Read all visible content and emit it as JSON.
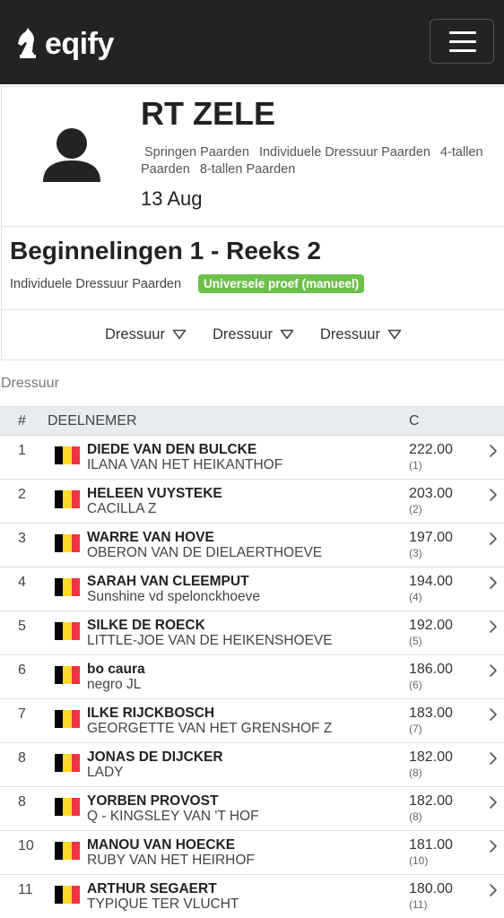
{
  "brand": {
    "name": "eqify"
  },
  "event": {
    "title": "RT ZELE",
    "tags": [
      "Springen Paarden",
      "Individuele Dressuur Paarden",
      "4-tallen Paarden",
      "8-tallen Paarden"
    ],
    "date": "13 Aug"
  },
  "class": {
    "title": "Beginnelingen 1 - Reeks 2",
    "discipline": "Individuele Dressuur Paarden",
    "badge": "Universele proef (manueel)",
    "badge_color": "#6cc04a"
  },
  "filters": [
    "Dressuur",
    "Dressuur",
    "Dressuur"
  ],
  "section_label": "Dressuur",
  "table": {
    "headers": {
      "rank": "#",
      "participant": "DEELNEMER",
      "score": "C"
    },
    "rows": [
      {
        "rank": "1",
        "rider": "DIEDE VAN DEN BULCKE",
        "horse": "ILANA VAN HET HEIKANTHOF",
        "score": "222.00",
        "place": "(1)",
        "flag": "BE"
      },
      {
        "rank": "2",
        "rider": "HELEEN VUYSTEKE",
        "horse": "CACILLA Z",
        "score": "203.00",
        "place": "(2)",
        "flag": "BE"
      },
      {
        "rank": "3",
        "rider": "WARRE VAN HOVE",
        "horse": "OBERON VAN DE DIELAERTHOEVE",
        "score": "197.00",
        "place": "(3)",
        "flag": "BE"
      },
      {
        "rank": "4",
        "rider": "SARAH VAN CLEEMPUT",
        "horse": "Sunshine vd spelonckhoeve",
        "score": "194.00",
        "place": "(4)",
        "flag": "BE"
      },
      {
        "rank": "5",
        "rider": "SILKE DE ROECK",
        "horse": "LITTLE-JOE VAN DE HEIKENSHOEVE",
        "score": "192.00",
        "place": "(5)",
        "flag": "BE"
      },
      {
        "rank": "6",
        "rider": "bo caura",
        "horse": "negro JL",
        "score": "186.00",
        "place": "(6)",
        "flag": "BE"
      },
      {
        "rank": "7",
        "rider": "ILKE RIJCKBOSCH",
        "horse": "GEORGETTE VAN HET GRENSHOF Z",
        "score": "183.00",
        "place": "(7)",
        "flag": "BE"
      },
      {
        "rank": "8",
        "rider": "JONAS DE DIJCKER",
        "horse": "LADY",
        "score": "182.00",
        "place": "(8)",
        "flag": "BE"
      },
      {
        "rank": "8",
        "rider": "YORBEN PROVOST",
        "horse": "Q - KINGSLEY VAN 'T HOF",
        "score": "182.00",
        "place": "(8)",
        "flag": "BE"
      },
      {
        "rank": "10",
        "rider": "MANOU VAN HOECKE",
        "horse": "RUBY VAN HET HEIRHOF",
        "score": "181.00",
        "place": "(10)",
        "flag": "BE"
      },
      {
        "rank": "11",
        "rider": "ARTHUR SEGAERT",
        "horse": "TYPIQUE TER VLUCHT",
        "score": "180.00",
        "place": "(11)",
        "flag": "BE"
      }
    ]
  },
  "icons": {
    "logo": "knight-chess-icon",
    "menu": "hamburger-menu-icon",
    "avatar": "user-avatar-icon",
    "filter_caret": "triangle-down-icon",
    "row_action": "chevron-right-icon",
    "flag": "belgium-flag-icon"
  },
  "colors": {
    "topbar": "#232323",
    "header_row": "#e9ecef",
    "badge": "#6cc04a",
    "flag_black": "#000000",
    "flag_yellow": "#fdda24",
    "flag_red": "#ef3340"
  }
}
